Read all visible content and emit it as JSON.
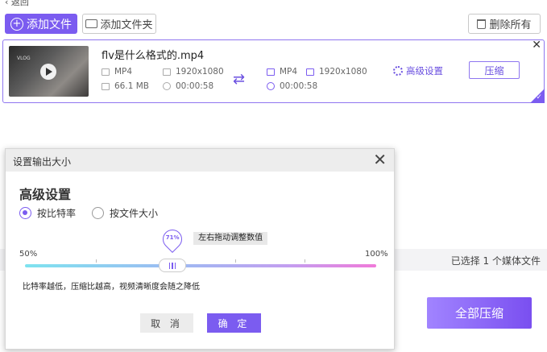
{
  "nav": {
    "back_label": "返回"
  },
  "toolbar": {
    "add_file": "添加文件",
    "add_folder": "添加文件夹",
    "delete_all": "删除所有"
  },
  "file": {
    "name": "flv是什么格式的.mp4",
    "thumbnail_caption": "VLOG",
    "source": {
      "format": "MP4",
      "resolution": "1920x1080",
      "size": "66.1 MB",
      "duration": "00:00:58"
    },
    "output": {
      "format": "MP4",
      "resolution": "1920x1080",
      "duration": "00:00:58"
    },
    "advanced_settings": "高级设置",
    "compress": "压缩",
    "close_glyph": "✕"
  },
  "footer": {
    "selected_text": "已选择 1 个媒体文件",
    "compress_all": "全部压缩"
  },
  "dialog": {
    "title": "设置输出大小",
    "close_glyph": "✕",
    "section_title": "高级设置",
    "options": [
      {
        "label": "按比特率",
        "selected": true
      },
      {
        "label": "按文件大小",
        "selected": false
      }
    ],
    "slider": {
      "min_label": "50%",
      "max_label": "100%",
      "value_label": "71%",
      "value": 71,
      "min": 50,
      "max": 100,
      "tooltip": "左右拖动调整数值"
    },
    "hint": "比特率越低，压缩比越高，视频清晰度会随之降低",
    "cancel": "取 消",
    "confirm": "确 定"
  },
  "colors": {
    "accent": "#7b5cf0"
  }
}
